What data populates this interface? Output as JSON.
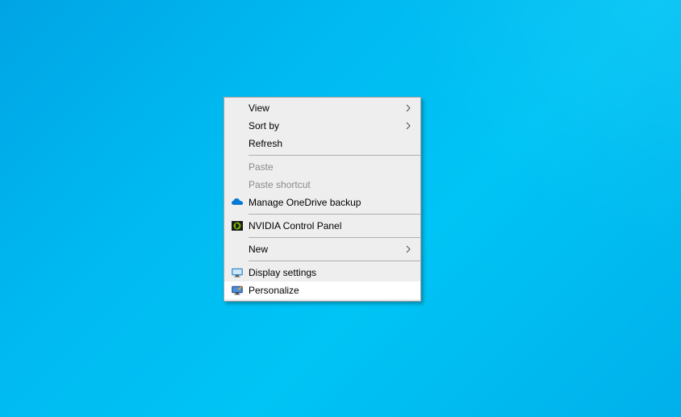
{
  "context_menu": {
    "items": [
      {
        "label": "View",
        "has_submenu": true,
        "enabled": true,
        "icon": null
      },
      {
        "label": "Sort by",
        "has_submenu": true,
        "enabled": true,
        "icon": null
      },
      {
        "label": "Refresh",
        "has_submenu": false,
        "enabled": true,
        "icon": null
      },
      {
        "separator": true
      },
      {
        "label": "Paste",
        "has_submenu": false,
        "enabled": false,
        "icon": null
      },
      {
        "label": "Paste shortcut",
        "has_submenu": false,
        "enabled": false,
        "icon": null
      },
      {
        "label": "Manage OneDrive backup",
        "has_submenu": false,
        "enabled": true,
        "icon": "onedrive"
      },
      {
        "separator": true
      },
      {
        "label": "NVIDIA Control Panel",
        "has_submenu": false,
        "enabled": true,
        "icon": "nvidia"
      },
      {
        "separator": true
      },
      {
        "label": "New",
        "has_submenu": true,
        "enabled": true,
        "icon": null
      },
      {
        "separator": true
      },
      {
        "label": "Display settings",
        "has_submenu": false,
        "enabled": true,
        "icon": "display"
      },
      {
        "label": "Personalize",
        "has_submenu": false,
        "enabled": true,
        "icon": "personalize",
        "hovered": true
      }
    ]
  }
}
